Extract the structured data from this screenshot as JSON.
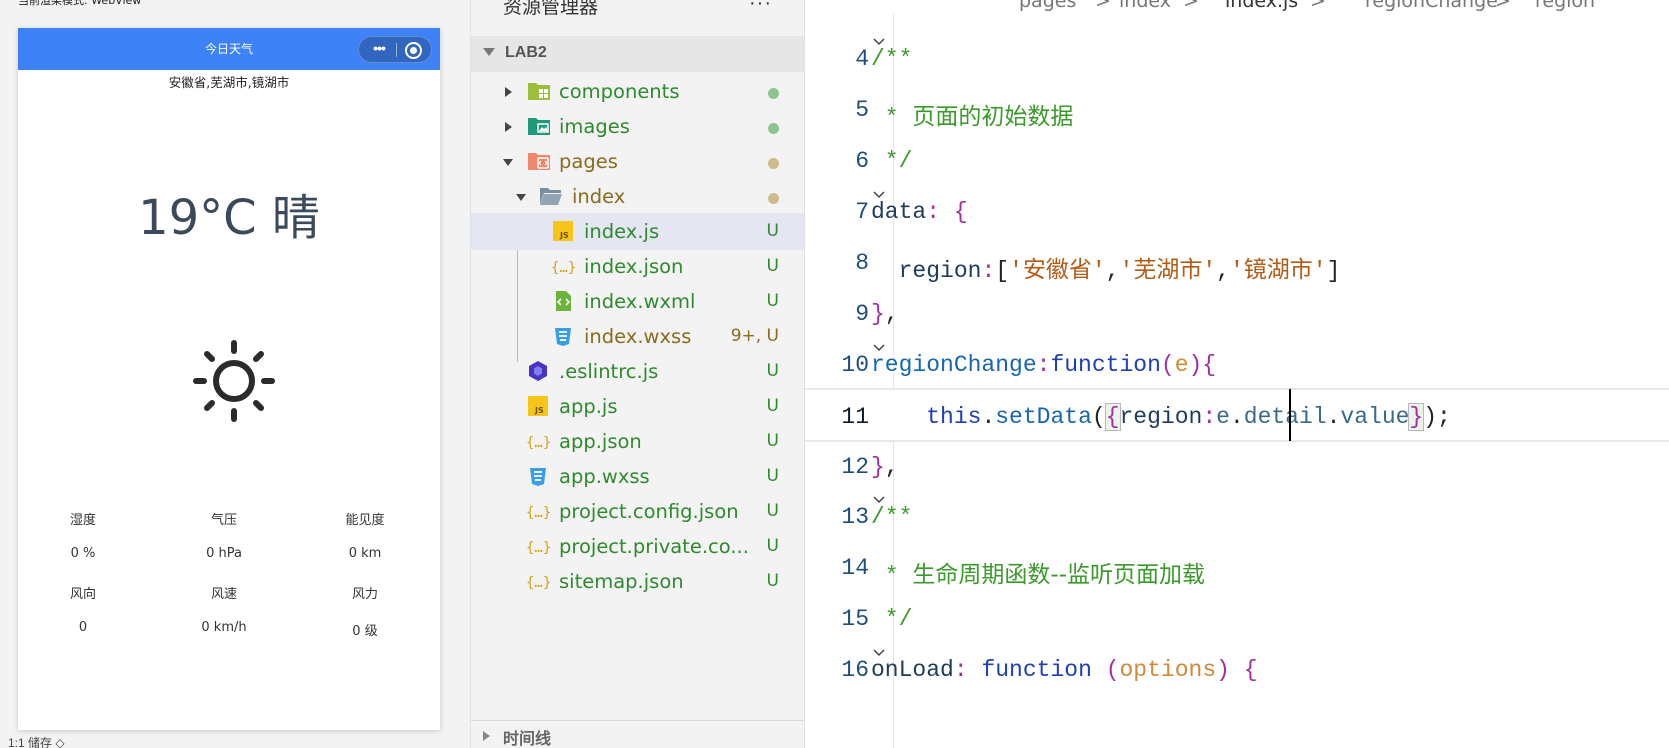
{
  "simulator": {
    "mode_label": "当前渲染模式: WebView",
    "nav_title": "今日天气",
    "capsule": {
      "more_icon": "more-dots-icon",
      "close_icon": "capsule-close-icon"
    },
    "region_text": "安徽省,芜湖市,镜湖市",
    "temperature": "19°C 晴",
    "weather_icon": "sun-icon",
    "grid": [
      [
        "湿度",
        "气压",
        "能见度"
      ],
      [
        "0 %",
        "0 hPa",
        "0 km"
      ],
      [
        "风向",
        "风速",
        "风力"
      ],
      [
        "0",
        "0 km/h",
        "0 级"
      ]
    ],
    "bottom_text": "1:1 储存 ◇"
  },
  "explorer": {
    "title": "资源管理器",
    "more": "···",
    "root": "LAB2",
    "items": [
      {
        "name": "components",
        "icon": "folder-components-icon",
        "status": "dot",
        "color": "green"
      },
      {
        "name": "images",
        "icon": "folder-images-icon",
        "status": "dot",
        "color": "green"
      },
      {
        "name": "pages",
        "icon": "folder-pages-icon",
        "status": "dot",
        "color": "olive"
      },
      {
        "name": "index",
        "icon": "folder-open-icon",
        "status": "dot",
        "color": "olive"
      },
      {
        "name": "index.js",
        "icon": "js-file-icon",
        "status": "U",
        "color": "green"
      },
      {
        "name": "index.json",
        "icon": "json-file-icon",
        "status": "U",
        "color": "green"
      },
      {
        "name": "index.wxml",
        "icon": "wxml-file-icon",
        "status": "U",
        "color": "green"
      },
      {
        "name": "index.wxss",
        "icon": "wxss-file-icon",
        "status": "9+, U",
        "color": "olive"
      },
      {
        "name": ".eslintrc.js",
        "icon": "eslint-file-icon",
        "status": "U",
        "color": "green"
      },
      {
        "name": "app.js",
        "icon": "js-file-icon",
        "status": "U",
        "color": "green"
      },
      {
        "name": "app.json",
        "icon": "json-file-icon",
        "status": "U",
        "color": "green"
      },
      {
        "name": "app.wxss",
        "icon": "wxss-file-icon",
        "status": "U",
        "color": "green"
      },
      {
        "name": "project.config.json",
        "icon": "json-file-icon",
        "status": "U",
        "color": "green"
      },
      {
        "name": "project.private.co...",
        "icon": "json-file-icon",
        "status": "U",
        "color": "green"
      },
      {
        "name": "sitemap.json",
        "icon": "json-file-icon",
        "status": "U",
        "color": "green"
      }
    ],
    "timeline": "时间线"
  },
  "editor": {
    "breadcrumb": [
      "pages",
      ">",
      "index",
      ">",
      "index.js",
      ">",
      "regionChange",
      ">",
      "region"
    ],
    "line_numbers": [
      "4",
      "5",
      "6",
      "7",
      "8",
      "9",
      "10",
      "11",
      "12",
      "13",
      "14",
      "15",
      "16"
    ],
    "current_line": "11"
  },
  "colors": {
    "nav_blue": "#3e82f7",
    "git_untracked": "#2f8a2f",
    "git_modified": "#8b6b1e",
    "comment": "#3a9a2a",
    "string": "#b45a14"
  }
}
